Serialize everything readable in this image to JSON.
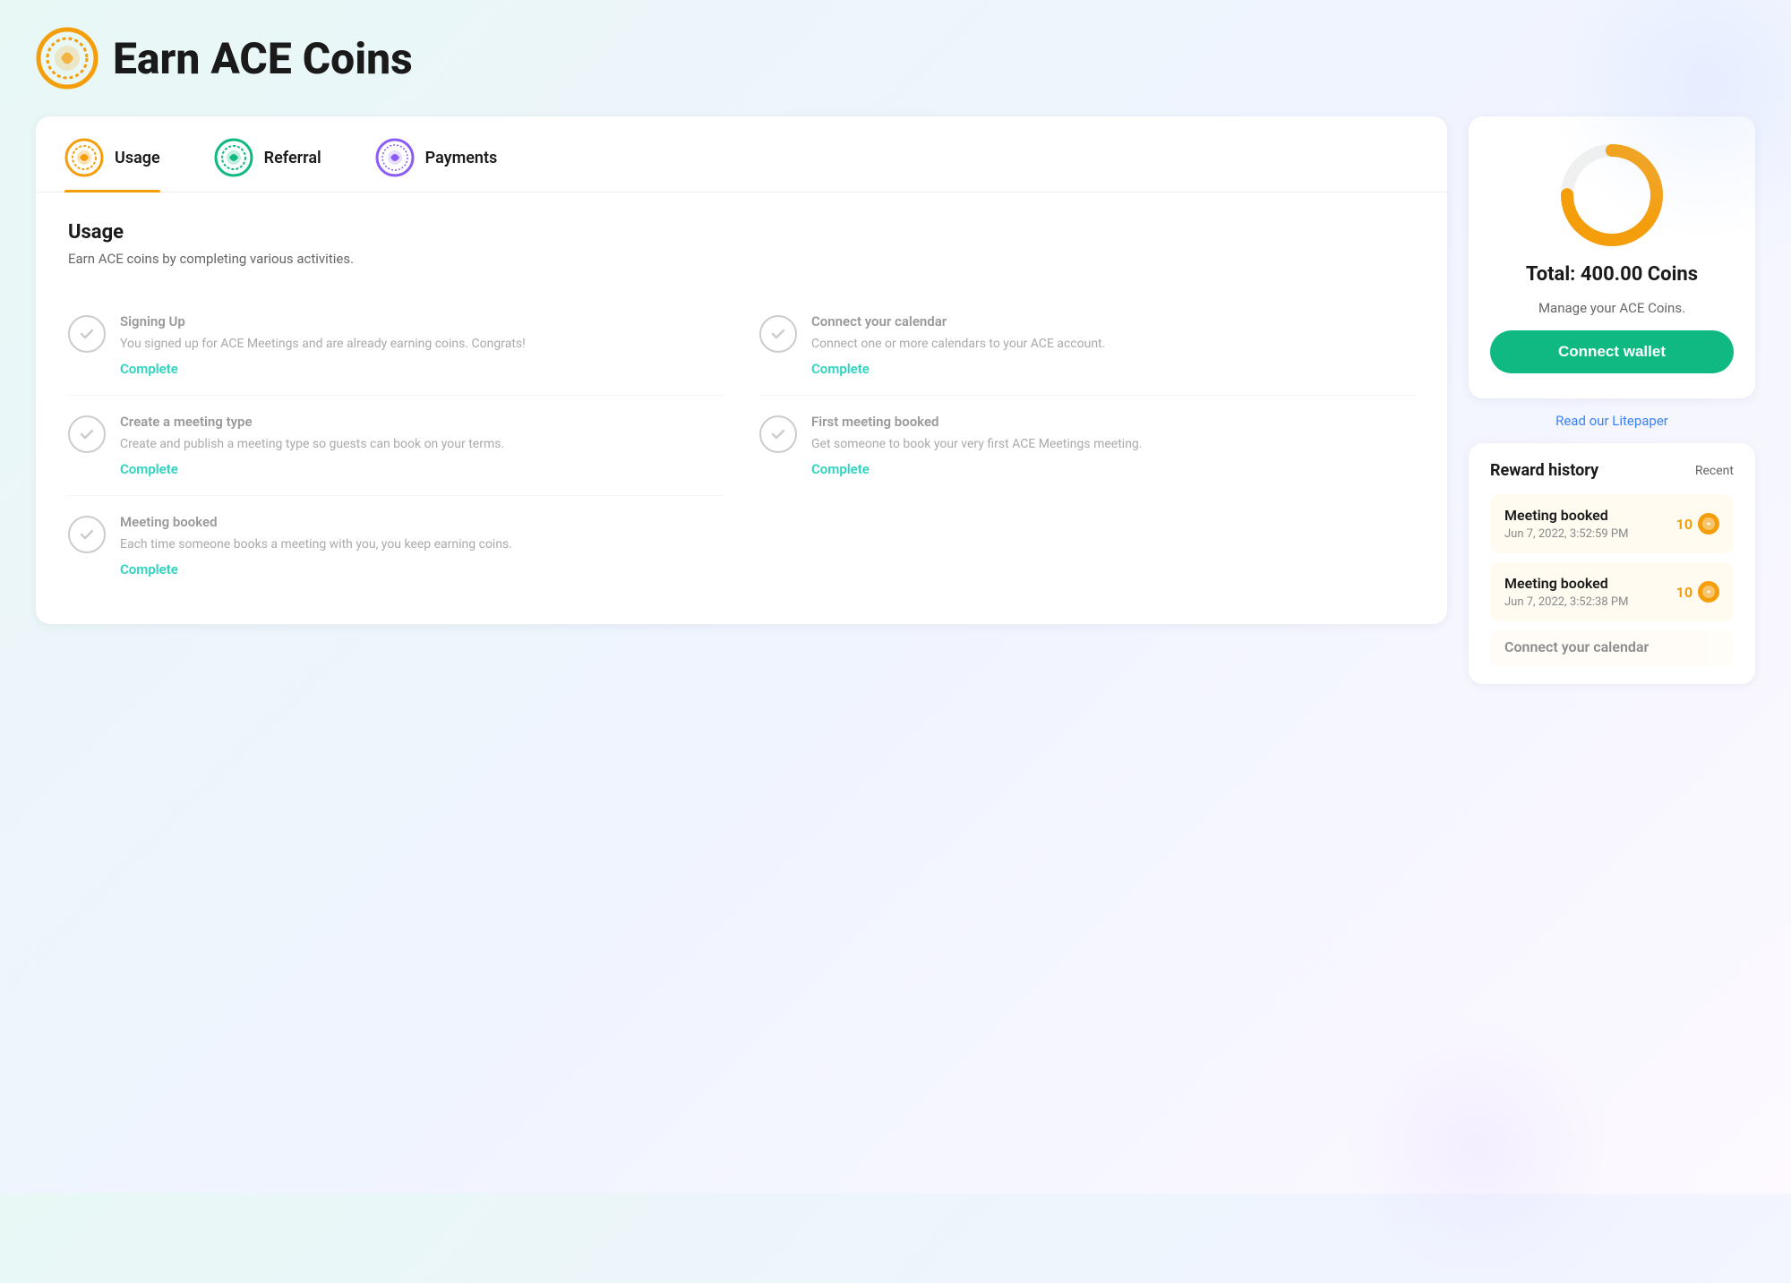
{
  "header": {
    "title": "Earn ACE Coins",
    "icon_label": "ace-coins-logo"
  },
  "tabs": [
    {
      "id": "usage",
      "label": "Usage",
      "active": true,
      "icon_color": "#f59e0b"
    },
    {
      "id": "referral",
      "label": "Referral",
      "active": false,
      "icon_color": "#10b981"
    },
    {
      "id": "payments",
      "label": "Payments",
      "active": false,
      "icon_color": "#8b5cf6"
    }
  ],
  "usage_section": {
    "title": "Usage",
    "subtitle": "Earn ACE coins by completing various activities.",
    "activities_left": [
      {
        "title": "Signing Up",
        "desc": "You signed up for ACE Meetings and are already earning coins. Congrats!",
        "status": "Complete"
      },
      {
        "title": "Create a meeting type",
        "desc": "Create and publish a meeting type so guests can book on your terms.",
        "status": "Complete"
      },
      {
        "title": "Meeting booked",
        "desc": "Each time someone books a meeting with you, you keep earning coins.",
        "status": "Complete"
      }
    ],
    "activities_right": [
      {
        "title": "Connect your calendar",
        "desc": "Connect one or more calendars to your ACE account.",
        "status": "Complete"
      },
      {
        "title": "First meeting booked",
        "desc": "Get someone to book your very first ACE Meetings meeting.",
        "status": "Complete"
      }
    ]
  },
  "coins_card": {
    "total_label": "Total: 400.00 Coins",
    "manage_label": "Manage your ACE Coins.",
    "connect_wallet_label": "Connect wallet",
    "donut_progress": 75,
    "donut_color": "#f59e0b",
    "donut_bg": "#f0f0f0"
  },
  "litepaper": {
    "text": "Read our Litepaper"
  },
  "reward_history": {
    "title": "Reward history",
    "filter": "Recent",
    "items": [
      {
        "name": "Meeting booked",
        "date": "Jun 7, 2022, 3:52:59 PM",
        "amount": "10"
      },
      {
        "name": "Meeting booked",
        "date": "Jun 7, 2022, 3:52:38 PM",
        "amount": "10"
      }
    ],
    "partial_item": "Connect your calendar"
  }
}
